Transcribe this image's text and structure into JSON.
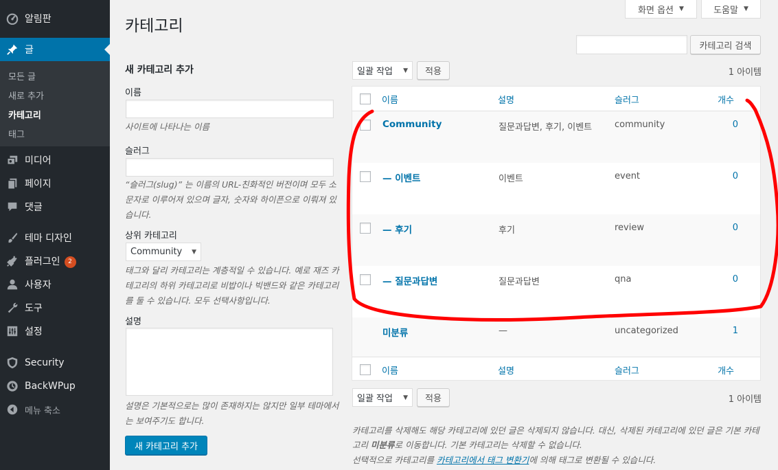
{
  "sidebar": {
    "items": [
      {
        "label": "알림판",
        "icon": "dashboard-icon"
      },
      {
        "label": "글",
        "icon": "pin-icon"
      },
      {
        "label": "미디어",
        "icon": "media-icon"
      },
      {
        "label": "페이지",
        "icon": "page-icon"
      },
      {
        "label": "댓글",
        "icon": "comment-icon"
      },
      {
        "label": "테마 디자인",
        "icon": "brush-icon"
      },
      {
        "label": "플러그인",
        "icon": "plugin-icon",
        "badge": "2"
      },
      {
        "label": "사용자",
        "icon": "user-icon"
      },
      {
        "label": "도구",
        "icon": "wrench-icon"
      },
      {
        "label": "설정",
        "icon": "settings-icon"
      },
      {
        "label": "Security",
        "icon": "shield-icon"
      },
      {
        "label": "BackWPup",
        "icon": "backup-icon"
      },
      {
        "label": "메뉴 축소",
        "icon": "collapse-icon"
      }
    ],
    "submenu": [
      "모든 글",
      "새로 추가",
      "카테고리",
      "태그"
    ]
  },
  "header": {
    "screen_options": "화면 옵션",
    "help": "도움말",
    "title": "카테고리",
    "search_button": "카테고리 검색",
    "search_value": ""
  },
  "form": {
    "heading": "새 카테고리 추가",
    "name_label": "이름",
    "name_value": "",
    "name_help": "사이트에 나타나는 이름",
    "slug_label": "슬러그",
    "slug_value": "",
    "slug_help": "“슬러그(slug)” 는 이름의 URL-친화적인 버전이며 모두 소문자로 이루어져 있으며 글자, 숫자와 하이픈으로 이뤄져 있습니다.",
    "parent_label": "상위 카테고리",
    "parent_selected": "Community",
    "parent_help": "태그와 달리 카테고리는 계층적일 수 있습니다. 예로 재즈 카테고리의 하위 카테고리로 비밥이나 빅밴드와 같은 카테고리를 둘 수 있습니다. 모두 선택사항입니다.",
    "desc_label": "설명",
    "desc_value": "",
    "desc_help": "설명은 기본적으로는 많이 존재하지는 않지만 일부 테마에서는 보여주기도 합니다.",
    "submit": "새 카테고리 추가"
  },
  "bulk": {
    "action": "일괄 작업",
    "apply": "적용",
    "items_count": "1 아이템"
  },
  "table": {
    "headers": {
      "name": "이름",
      "description": "설명",
      "slug": "슬러그",
      "count": "개수"
    },
    "rows": [
      {
        "name": "Community",
        "description": "질문과답변, 후기, 이벤트",
        "slug": "community",
        "count": "0"
      },
      {
        "name": "— 이벤트",
        "description": "이벤트",
        "slug": "event",
        "count": "0"
      },
      {
        "name": "— 후기",
        "description": "후기",
        "slug": "review",
        "count": "0"
      },
      {
        "name": "— 질문과답변",
        "description": "질문과답변",
        "slug": "qna",
        "count": "0"
      },
      {
        "name": "미분류",
        "description": "—",
        "slug": "uncategorized",
        "count": "1"
      }
    ]
  },
  "notes": {
    "note1_a": "카테고리를 삭제해도 해당 카테고리에 있던 글은 삭제되지 않습니다. 대신, 삭제된 카테고리에 있던 글은 기본 카테고리 ",
    "note1_b": "미분류",
    "note1_c": "로 이동합니다. 기본 카테고리는 삭제할 수 없습니다.",
    "note2_a": "선택적으로 카테고리를 ",
    "note2_link": "카테고리에서 태그 변환기",
    "note2_b": "에 의해 태그로 변환될 수 있습니다."
  },
  "colors": {
    "accent": "#0073aa",
    "sidebar": "#23282d",
    "annotation": "#ff0000"
  }
}
